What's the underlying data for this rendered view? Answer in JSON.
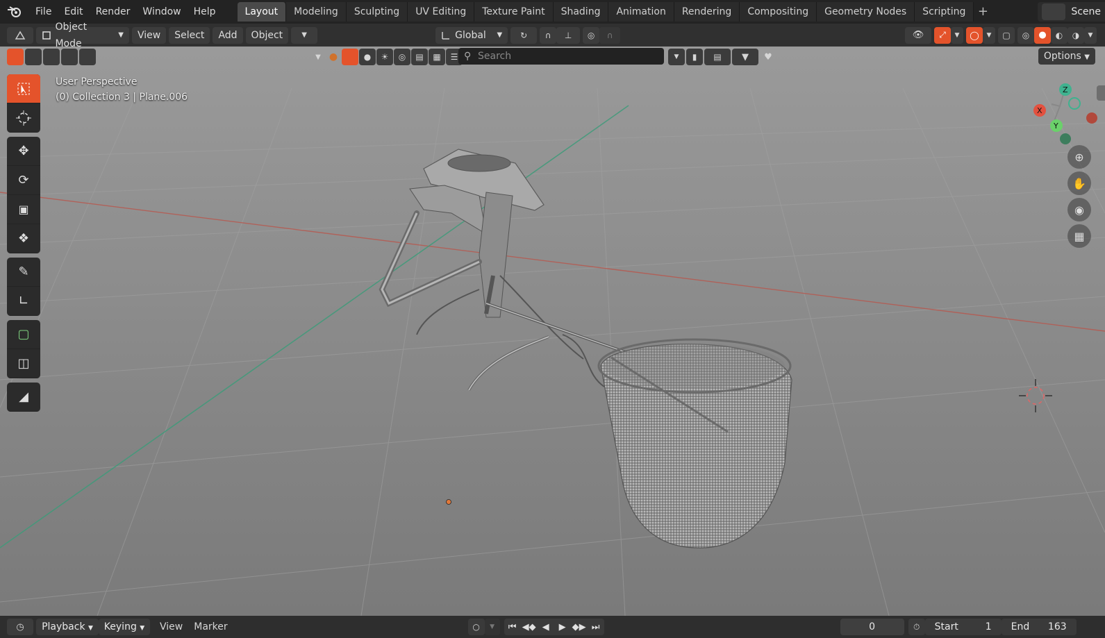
{
  "menu": {
    "items": [
      "File",
      "Edit",
      "Render",
      "Window",
      "Help"
    ]
  },
  "workspaces": {
    "tabs": [
      "Layout",
      "Modeling",
      "Sculpting",
      "UV Editing",
      "Texture Paint",
      "Shading",
      "Animation",
      "Rendering",
      "Compositing",
      "Geometry Nodes",
      "Scripting"
    ],
    "active": "Layout"
  },
  "scene": {
    "label": "Scene"
  },
  "header": {
    "mode": "Object Mode",
    "view": "View",
    "select": "Select",
    "add": "Add",
    "object": "Object",
    "transform_orientation": "Global"
  },
  "viewport": {
    "search_placeholder": "Search",
    "options": "Options",
    "overlay_line1": "User Perspective",
    "overlay_line2": "(0) Collection 3 | Plane.006",
    "axes": {
      "x": "X",
      "y": "Y",
      "z": "Z"
    }
  },
  "timeline": {
    "playback": "Playback",
    "keying": "Keying",
    "view": "View",
    "marker": "Marker",
    "current_frame": "0",
    "start_label": "Start",
    "start_value": "1",
    "end_label": "End",
    "end_value": "163"
  },
  "colors": {
    "accent": "#e4532b",
    "x_axis": "#c24b3f",
    "y_axis": "#4f9f7c",
    "gizmo_x": "#e3513f",
    "gizmo_y": "#6ad16a",
    "gizmo_z": "#3fb28f"
  }
}
